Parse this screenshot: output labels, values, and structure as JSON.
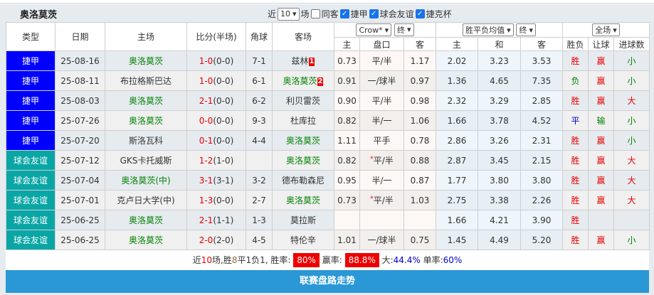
{
  "team": "奥洛莫茨",
  "filters": {
    "recent_label": "近",
    "recent_value": "10",
    "games_label": "场",
    "same_label": "同客",
    "same_checked": false,
    "leagues": [
      {
        "label": "捷甲",
        "checked": true
      },
      {
        "label": "球会友谊",
        "checked": true
      },
      {
        "label": "捷克杯",
        "checked": true
      }
    ]
  },
  "headers": {
    "type": "类型",
    "date": "日期",
    "home": "主场",
    "score": "比分(半场)",
    "corner": "角球",
    "away": "客场",
    "company_select": "Crow*",
    "asian_time_select": "终",
    "euro_select": "胜平负均值",
    "euro_time_select": "终",
    "scope_select": "全场",
    "sub": [
      "主",
      "盘口",
      "客",
      "主",
      "和",
      "客",
      "胜负",
      "让球",
      "进球数"
    ]
  },
  "colors": {
    "league": "#0000ff",
    "friendly": "#0aa6a6",
    "win": "#e60000",
    "draw": "#0000cc",
    "loss": "#008000"
  },
  "rows": [
    {
      "type": "捷甲",
      "kind": "league",
      "date": "25-08-16",
      "home": "奥洛莫茨",
      "home_hl": true,
      "score": "1-0",
      "half": "(0-0)",
      "corner": "7-1",
      "away": "兹林",
      "away_hl": false,
      "away_badge": "1",
      "ah": "0.73",
      "hc": "平/半",
      "aa": "1.17",
      "eh": "2.02",
      "ed": "3.23",
      "ea": "3.53",
      "res": "胜",
      "rc": "r",
      "cover": "赢",
      "cc": "r",
      "ou": "小",
      "oc": "g"
    },
    {
      "type": "捷甲",
      "kind": "league",
      "date": "25-08-11",
      "home": "布拉格斯巴达",
      "home_hl": false,
      "score": "1-0",
      "half": "(0-0)",
      "corner": "6-1",
      "away": "奥洛莫茨",
      "away_hl": true,
      "away_badge": "2",
      "ah": "0.91",
      "hc": "一/球半",
      "aa": "0.97",
      "eh": "1.36",
      "ed": "4.65",
      "ea": "7.35",
      "res": "负",
      "rc": "g",
      "cover": "赢",
      "cc": "r",
      "ou": "小",
      "oc": "g"
    },
    {
      "type": "捷甲",
      "kind": "league",
      "date": "25-08-03",
      "home": "奥洛莫茨",
      "home_hl": true,
      "score": "2-1",
      "half": "(0-0)",
      "corner": "6-2",
      "away": "利贝雷茨",
      "away_hl": false,
      "ah": "0.90",
      "hc": "平/半",
      "aa": "0.98",
      "eh": "2.32",
      "ed": "3.29",
      "ea": "2.85",
      "res": "胜",
      "rc": "r",
      "cover": "赢",
      "cc": "r",
      "ou": "大",
      "oc": "r"
    },
    {
      "type": "捷甲",
      "kind": "league",
      "date": "25-07-26",
      "home": "奥洛莫茨",
      "home_hl": true,
      "score": "0-0",
      "half": "(0-0)",
      "corner": "9-3",
      "away": "杜库拉",
      "away_hl": false,
      "ah": "0.82",
      "hc": "半/一",
      "aa": "1.06",
      "eh": "1.66",
      "ed": "3.78",
      "ea": "4.52",
      "res": "平",
      "rc": "b",
      "cover": "输",
      "cc": "g",
      "ou": "小",
      "oc": "g"
    },
    {
      "type": "捷甲",
      "kind": "league",
      "date": "25-07-20",
      "home": "斯洛瓦科",
      "home_hl": false,
      "score": "0-1",
      "half": "(0-0)",
      "corner": "4-4",
      "away": "奥洛莫茨",
      "away_hl": true,
      "ah": "1.11",
      "hc": "平手",
      "aa": "0.78",
      "eh": "2.86",
      "ed": "3.26",
      "ea": "2.31",
      "res": "胜",
      "rc": "r",
      "cover": "赢",
      "cc": "r",
      "ou": "小",
      "oc": "g"
    },
    {
      "type": "球会友谊",
      "kind": "friendly",
      "date": "25-07-12",
      "home": "GKS卡托威斯",
      "home_hl": false,
      "score": "1-2",
      "half": "(1-0)",
      "corner": "",
      "away": "奥洛莫茨",
      "away_hl": true,
      "ah": "0.82",
      "hc": "平/半",
      "hc_star": "*",
      "aa": "0.88",
      "eh": "2.87",
      "ed": "3.45",
      "ea": "2.15",
      "res": "胜",
      "rc": "r",
      "cover": "赢",
      "cc": "r",
      "ou": "大",
      "oc": "r"
    },
    {
      "type": "球会友谊",
      "kind": "friendly",
      "date": "25-07-04",
      "home": "奥洛莫茨(中)",
      "home_hl": true,
      "score": "3-1",
      "half": "(3-1)",
      "corner": "3-2",
      "away": "德布勒森尼",
      "away_hl": false,
      "ah": "0.95",
      "hc": "半/一",
      "aa": "0.87",
      "eh": "1.77",
      "ed": "3.80",
      "ea": "3.80",
      "res": "胜",
      "rc": "r",
      "cover": "赢",
      "cc": "r",
      "ou": "大",
      "oc": "r"
    },
    {
      "type": "球会友谊",
      "kind": "friendly",
      "date": "25-07-01",
      "home": "克卢日大学(中)",
      "home_hl": false,
      "score": "1-3",
      "half": "(0-0)",
      "corner": "2-7",
      "away": "奥洛莫茨",
      "away_hl": true,
      "ah": "0.73",
      "hc": "平/半",
      "hc_star": "*",
      "aa": "1.03",
      "eh": "2.75",
      "ed": "3.38",
      "ea": "2.26",
      "res": "胜",
      "rc": "r",
      "cover": "赢",
      "cc": "r",
      "ou": "大",
      "oc": "r"
    },
    {
      "type": "球会友谊",
      "kind": "friendly",
      "date": "25-06-25",
      "home": "奥洛莫茨",
      "home_hl": true,
      "score": "2-1",
      "half": "(1-1)",
      "corner": "1-3",
      "away": "莫拉斯",
      "away_hl": false,
      "ah": "",
      "hc": "",
      "aa": "",
      "eh": "1.66",
      "ed": "4.21",
      "ea": "3.90",
      "res": "胜",
      "rc": "r",
      "cover": "",
      "cc": "r",
      "ou": "",
      "oc": "g"
    },
    {
      "type": "球会友谊",
      "kind": "friendly",
      "date": "25-06-25",
      "home": "奥洛莫茨",
      "home_hl": true,
      "score": "2-0",
      "half": "(2-0)",
      "corner": "4-5",
      "away": "特伦辛",
      "away_hl": false,
      "ah": "1.01",
      "hc": "一/球半",
      "aa": "0.75",
      "eh": "1.45",
      "ed": "4.49",
      "ea": "5.20",
      "res": "胜",
      "rc": "r",
      "cover": "赢",
      "cc": "r",
      "ou": "小",
      "oc": "g"
    }
  ],
  "summary": {
    "p1": "近",
    "n": "10",
    "p2": "场,胜",
    "w": "8",
    "p3": "平1负1, 胜率:",
    "win_rate": "80%",
    "p4": "赢率:",
    "cover_rate": "88.8%",
    "p5": "大:",
    "over_rate": "44.4%",
    "p6": "单率:",
    "odd_rate": "60%"
  },
  "footer_bar": "联赛盘路走势"
}
